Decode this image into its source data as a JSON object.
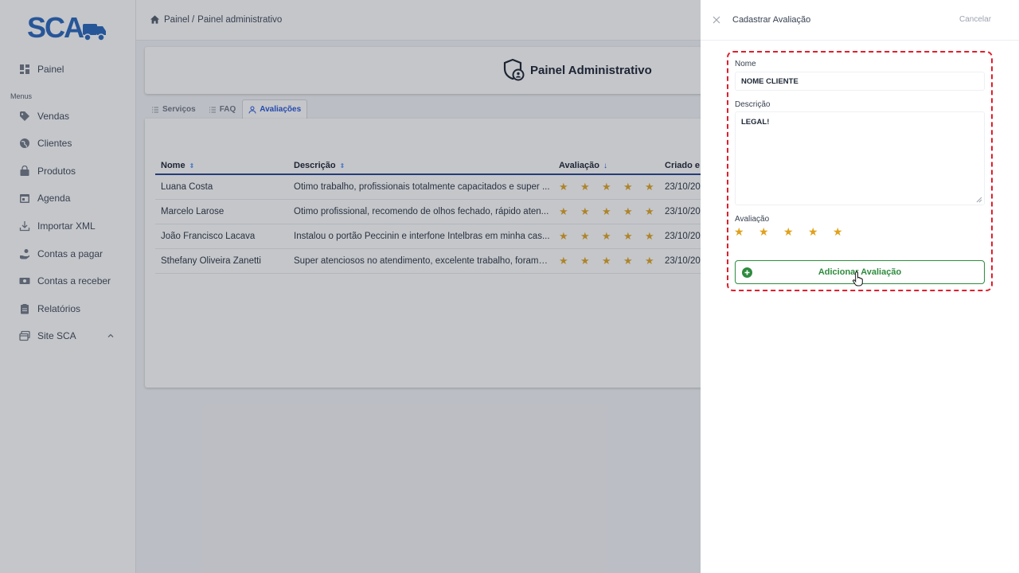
{
  "app": {
    "logo_text": "SCA",
    "brand_color": "#1f5fb8"
  },
  "sidebar": {
    "top_item": {
      "label": "Painel",
      "icon": "dashboard-icon"
    },
    "section_label": "Menus",
    "items": [
      {
        "label": "Vendas",
        "icon": "tag-icon"
      },
      {
        "label": "Clientes",
        "icon": "globe-icon"
      },
      {
        "label": "Produtos",
        "icon": "shopping-bag-icon"
      },
      {
        "label": "Agenda",
        "icon": "calendar-icon"
      },
      {
        "label": "Importar XML",
        "icon": "download-icon"
      },
      {
        "label": "Contas a pagar",
        "icon": "hand-coins-icon"
      },
      {
        "label": "Contas a receber",
        "icon": "banknote-icon"
      },
      {
        "label": "Relatórios",
        "icon": "clipboard-icon"
      },
      {
        "label": "Site SCA",
        "icon": "browser-window-icon",
        "expanded": true
      }
    ]
  },
  "breadcrumb": {
    "home": "Painel",
    "separator": "/",
    "current": "Painel administrativo"
  },
  "header": {
    "title": "Painel Administrativo"
  },
  "tabs": [
    {
      "label": "Serviços",
      "icon": "list-icon",
      "active": false
    },
    {
      "label": "FAQ",
      "icon": "list-icon",
      "active": false
    },
    {
      "label": "Avaliações",
      "icon": "users-icon",
      "active": true
    }
  ],
  "table": {
    "columns": [
      "Nome",
      "Descrição",
      "Avaliação",
      "Criado e"
    ],
    "rows": [
      {
        "nome": "Luana Costa",
        "descricao": "Ótimo trabalho, profissionais totalmente capacitados e super ...",
        "stars": 5,
        "criado": "23/10/20"
      },
      {
        "nome": "Marcelo Larose",
        "descricao": "Otimo profissional, recomendo de olhos fechado, rápido aten...",
        "stars": 5,
        "criado": "23/10/20"
      },
      {
        "nome": "João Francisco Lacava",
        "descricao": "Instalou o portão Peccinin e interfone Intelbras em minha cas...",
        "stars": 5,
        "criado": "23/10/20"
      },
      {
        "nome": "Sthefany Oliveira Zanetti",
        "descricao": "Super atenciosos no atendimento, excelente trabalho, foram i...",
        "stars": 5,
        "criado": "23/10/20"
      }
    ],
    "star_color": "#e0a11b"
  },
  "drawer": {
    "title": "Cadastrar Avaliação",
    "cancel_label": "Cancelar",
    "nome_label": "Nome",
    "nome_value": "NOME CLIENTE",
    "descricao_label": "Descrição",
    "descricao_value": "LEGAL!",
    "avaliacao_label": "Avaliação",
    "rating": 5,
    "submit_label": "Adicionar Avaliação",
    "submit_color": "#2e8b3e",
    "highlight_color": "#e11d2a"
  }
}
